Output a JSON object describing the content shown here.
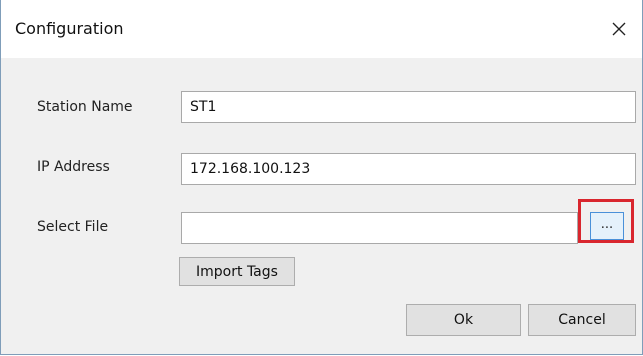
{
  "window": {
    "title": "Configuration"
  },
  "form": {
    "station_name_label": "Station Name",
    "station_name_value": "ST1",
    "ip_address_label": "IP Address",
    "ip_address_value": "172.168.100.123",
    "select_file_label": "Select File",
    "select_file_value": "",
    "browse_label": "...",
    "import_tags_label": "Import Tags"
  },
  "footer": {
    "ok_label": "Ok",
    "cancel_label": "Cancel"
  },
  "icons": {
    "close": "close-icon"
  },
  "colors": {
    "highlight": "#d9262e",
    "focus_border": "#4a90d9"
  }
}
